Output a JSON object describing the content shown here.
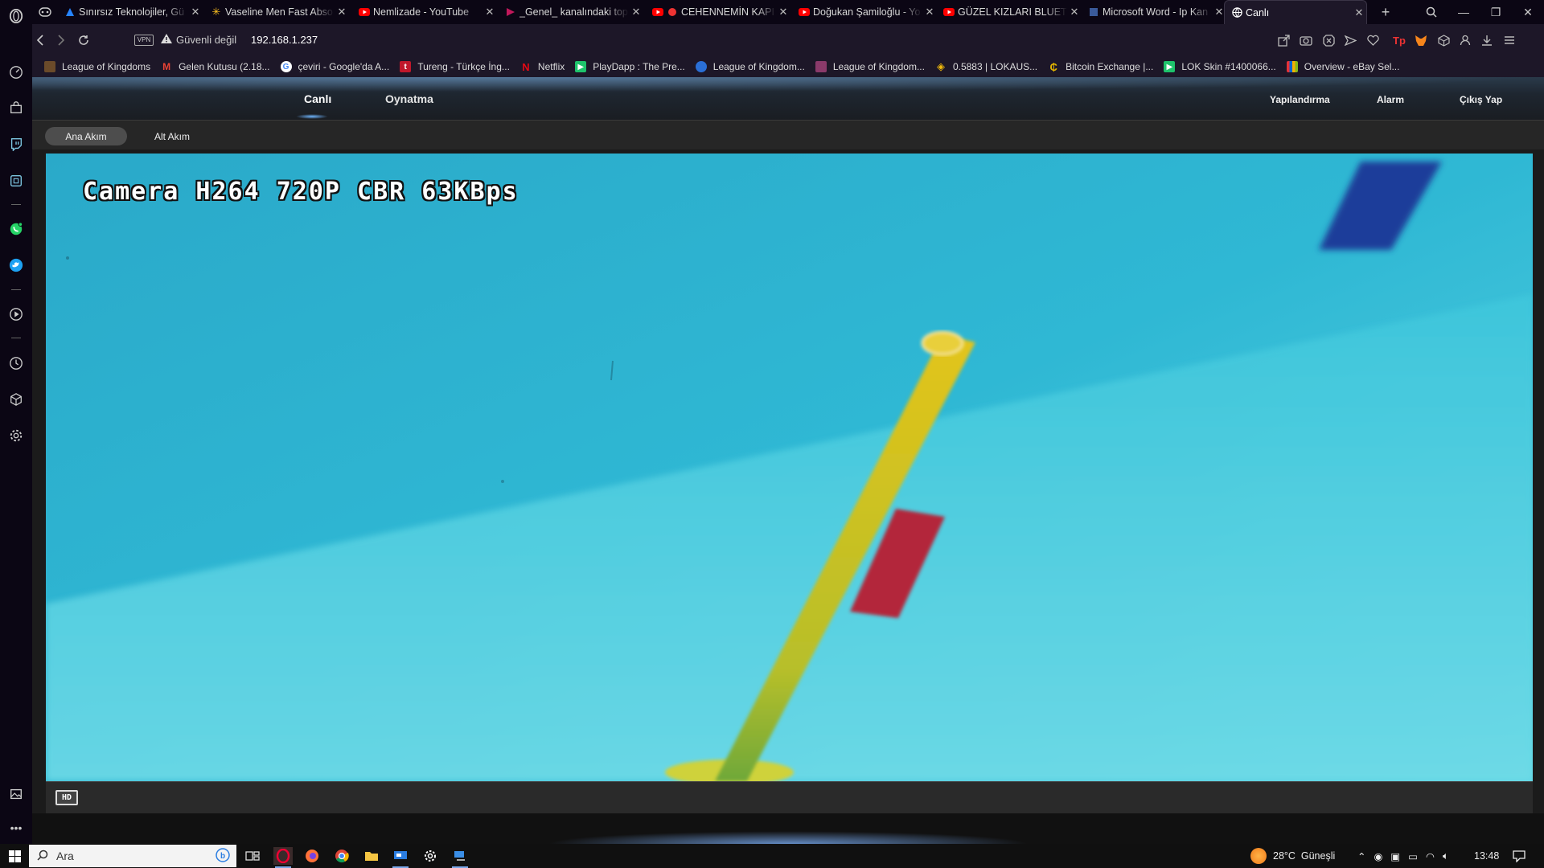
{
  "browser": {
    "tabs": [
      {
        "title": "Sınırsız Teknolojiler, Gü",
        "icon": "atlassian-icon"
      },
      {
        "title": "Vaseline Men Fast Abso",
        "icon": "walmart-icon"
      },
      {
        "title": "Nemlizade - YouTube",
        "icon": "youtube-icon"
      },
      {
        "title": "_Genel_ kanalındaki top",
        "icon": "stream-icon"
      },
      {
        "title": "CEHENNEMİN KAPI",
        "icon": "youtube-icon"
      },
      {
        "title": "Doğukan Şamiloğlu - Yo",
        "icon": "youtube-icon"
      },
      {
        "title": "GÜZEL KIZLARI BLUETO",
        "icon": "youtube-icon"
      },
      {
        "title": "Microsoft Word - Ip Kan",
        "icon": "document-icon"
      },
      {
        "title": "Canlı",
        "icon": "globe-icon",
        "active": true
      }
    ],
    "vpn_label": "VPN",
    "security_label": "Güvenli değil",
    "url": "192.168.1.237",
    "bookmarks": [
      {
        "label": "League of Kingdoms",
        "icon": "lok-icon",
        "color": "#6b4b2a"
      },
      {
        "label": "Gelen Kutusu (2.18...",
        "icon": "gmail-icon",
        "color": "#ffffff"
      },
      {
        "label": "çeviri - Google'da A...",
        "icon": "google-icon",
        "color": "#ffffff"
      },
      {
        "label": "Tureng - Türkçe İng...",
        "icon": "tureng-icon",
        "color": "#c0182b"
      },
      {
        "label": "Netflix",
        "icon": "netflix-icon",
        "color": "#e50914"
      },
      {
        "label": "PlayDapp : The Pre...",
        "icon": "playdapp-icon",
        "color": "#1ec36b"
      },
      {
        "label": "League of Kingdom...",
        "icon": "lok-icon",
        "color": "#2a6fd6"
      },
      {
        "label": "League of Kingdom...",
        "icon": "lok-icon",
        "color": "#8a3a6a"
      },
      {
        "label": "0.5883 | LOKAUS...",
        "icon": "binance-icon",
        "color": "#f0b90b"
      },
      {
        "label": "Bitcoin Exchange |...",
        "icon": "bitcoin-icon",
        "color": "#e6b800"
      },
      {
        "label": "LOK Skin #1400066...",
        "icon": "playdapp-icon",
        "color": "#1ec36b"
      },
      {
        "label": "Overview - eBay Sel...",
        "icon": "ebay-icon",
        "color": "#e53238"
      }
    ]
  },
  "camera_app": {
    "nav": {
      "live": "Canlı",
      "playback": "Oynatma",
      "config": "Yapılandırma",
      "alarm": "Alarm",
      "logout": "Çıkış Yap"
    },
    "streams": {
      "main": "Ana Akım",
      "sub": "Alt Akım",
      "active": "main"
    },
    "osd_text": "Camera H264 720P CBR 63KBps",
    "hd_button_label": "HD"
  },
  "taskbar": {
    "search_placeholder": "Ara",
    "weather": "28°C  Güneşli",
    "time": "13:48"
  },
  "colors": {
    "accent": "#6fb6ff",
    "video_water": "#2fb6d2",
    "pole": "#d9c21c",
    "red_block": "#b3263a"
  }
}
